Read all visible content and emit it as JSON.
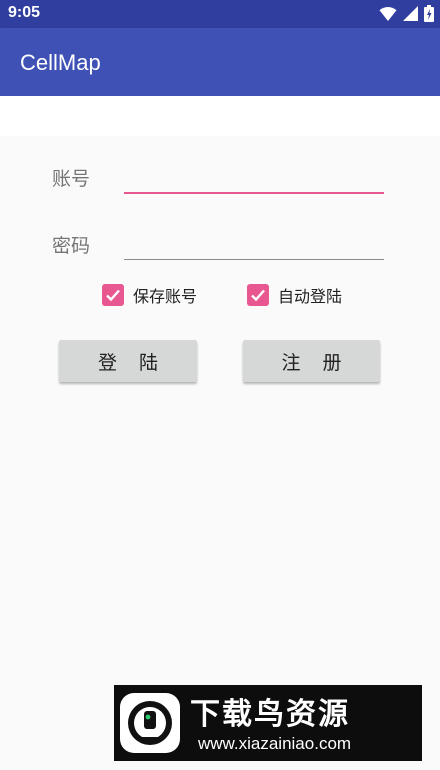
{
  "status_bar": {
    "time": "9:05",
    "icons": [
      "wifi-icon",
      "cell-signal-icon",
      "battery-icon"
    ],
    "color": "#303f9f"
  },
  "app_bar": {
    "title": "CellMap",
    "color": "#3f51b5"
  },
  "form": {
    "account": {
      "label": "账号",
      "value": ""
    },
    "password": {
      "label": "密码",
      "value": ""
    },
    "save_account": {
      "label": "保存账号",
      "checked": true
    },
    "auto_login": {
      "label": "自动登陆",
      "checked": true
    },
    "login_button": "登陆",
    "register_button": "注册",
    "accent_color": "#e8578f"
  },
  "watermark": {
    "title": "下载鸟资源",
    "url": "www.xiazainiao.com"
  }
}
